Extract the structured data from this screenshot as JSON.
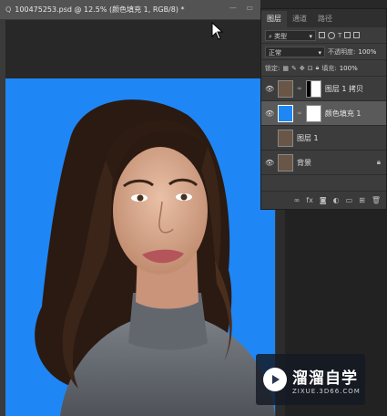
{
  "document": {
    "tab_title": "100475253.psd @ 12.5% (颜色填充 1, RGB/8) *",
    "close_glyph": "Q",
    "canvas_color": "#1f86f5"
  },
  "layers_panel": {
    "tabs": [
      {
        "label": "图层",
        "active": true
      },
      {
        "label": "通道",
        "active": false
      },
      {
        "label": "路径",
        "active": false
      }
    ],
    "filter": {
      "label": "类型"
    },
    "blend_mode": "正常",
    "opacity_label": "不透明度:",
    "opacity_value": "100%",
    "lock_label": "锁定:",
    "fill_label": "填充:",
    "fill_value": "100%",
    "layers": [
      {
        "name": "图层 1 拷贝",
        "visible": true,
        "selected": false,
        "has_mask": true
      },
      {
        "name": "颜色填充 1",
        "visible": true,
        "selected": true,
        "has_mask": true
      },
      {
        "name": "图层 1",
        "visible": false,
        "selected": false,
        "has_mask": false
      },
      {
        "name": "背景",
        "visible": true,
        "selected": false,
        "has_mask": false,
        "locked": true
      }
    ],
    "bottom_icons": [
      "link-icon",
      "fx-icon",
      "mask-icon",
      "adjustment-icon",
      "group-icon",
      "new-layer-icon",
      "trash-icon"
    ],
    "fx_label": "fx"
  },
  "watermark": {
    "title": "溜溜自学",
    "subtitle": "ZIXUE.3D66.COM"
  }
}
